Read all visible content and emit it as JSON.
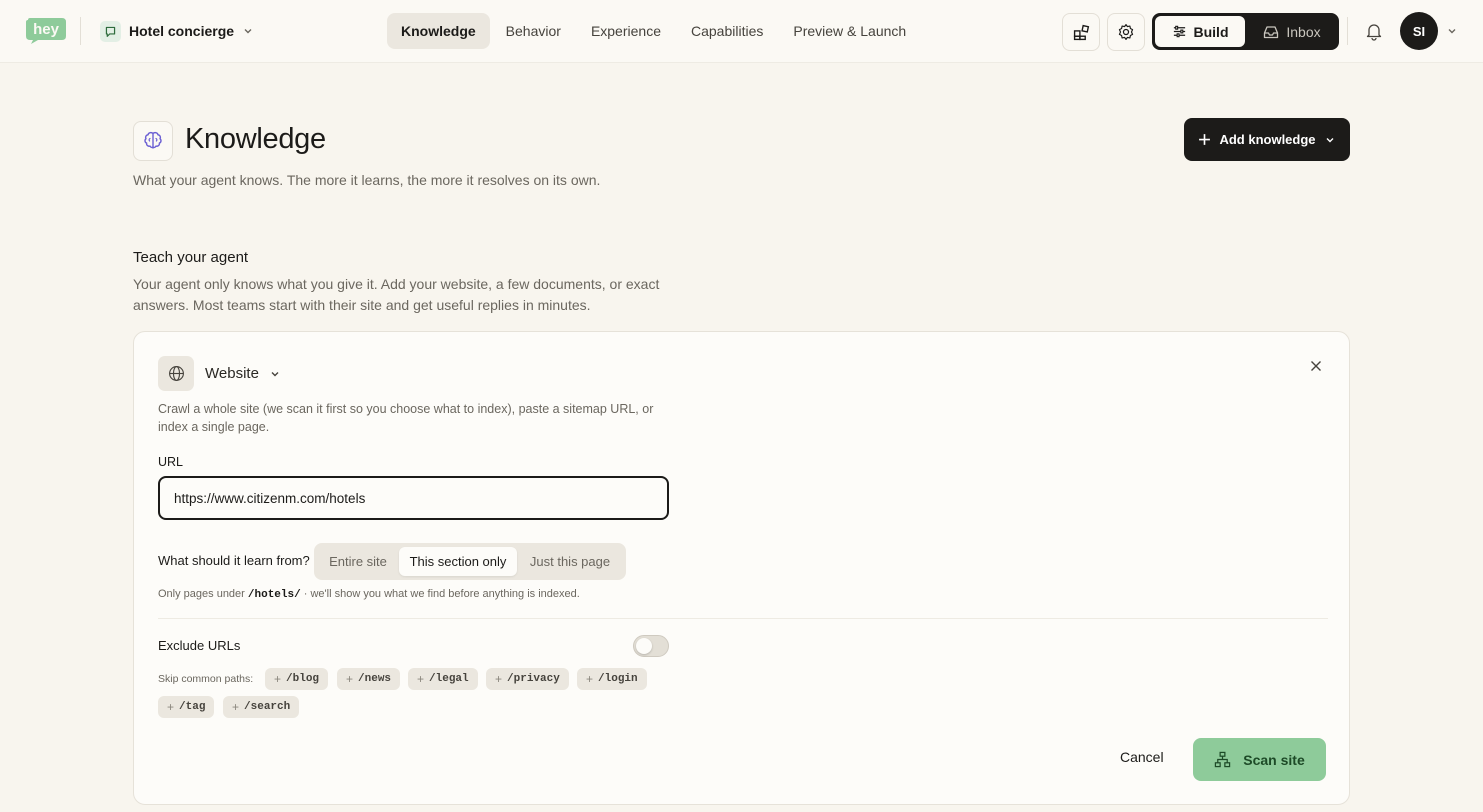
{
  "brand": {
    "logo_text": "hey",
    "accent": "#8ecb9a"
  },
  "agent_selector": {
    "name": "Hotel concierge",
    "icon": "chat-bubble-icon"
  },
  "nav": {
    "tabs": [
      {
        "label": "Knowledge",
        "active": true
      },
      {
        "label": "Behavior",
        "active": false
      },
      {
        "label": "Experience",
        "active": false
      },
      {
        "label": "Capabilities",
        "active": false
      },
      {
        "label": "Preview & Launch",
        "active": false
      }
    ]
  },
  "toolbar": {
    "widgets_icon": "widgets-icon",
    "settings_icon": "gear-icon",
    "build_label": "Build",
    "inbox_label": "Inbox",
    "notifications_icon": "bell-icon",
    "avatar_initials": "SI"
  },
  "header": {
    "title": "Knowledge",
    "subtitle": "What your agent knows. The more it learns, the more it resolves on its own.",
    "add_button": "Add knowledge"
  },
  "teach": {
    "title": "Teach your agent",
    "description": "Your agent only knows what you give it. Add your website, a few documents, or exact answers. Most teams start with their site and get useful replies in minutes."
  },
  "card": {
    "source_type": "Website",
    "source_description": "Crawl a whole site (we scan it first so you choose what to index), paste a sitemap URL, or index a single page.",
    "url_label": "URL",
    "url_value": "https://www.citizenm.com/hotels",
    "scope_label": "What should it learn from?",
    "scope_options": [
      "Entire site",
      "This section only",
      "Just this page"
    ],
    "scope_selected": "This section only",
    "hint_prefix": "Only pages under ",
    "hint_path": "/hotels/",
    "hint_suffix": " · we'll show you what we find before anything is indexed.",
    "exclude_label": "Exclude URLs",
    "exclude_enabled": false,
    "skip_label": "Skip common paths:",
    "skip_paths": [
      "/blog",
      "/news",
      "/legal",
      "/privacy",
      "/login",
      "/tag",
      "/search"
    ],
    "cancel_label": "Cancel",
    "scan_label": "Scan site"
  }
}
